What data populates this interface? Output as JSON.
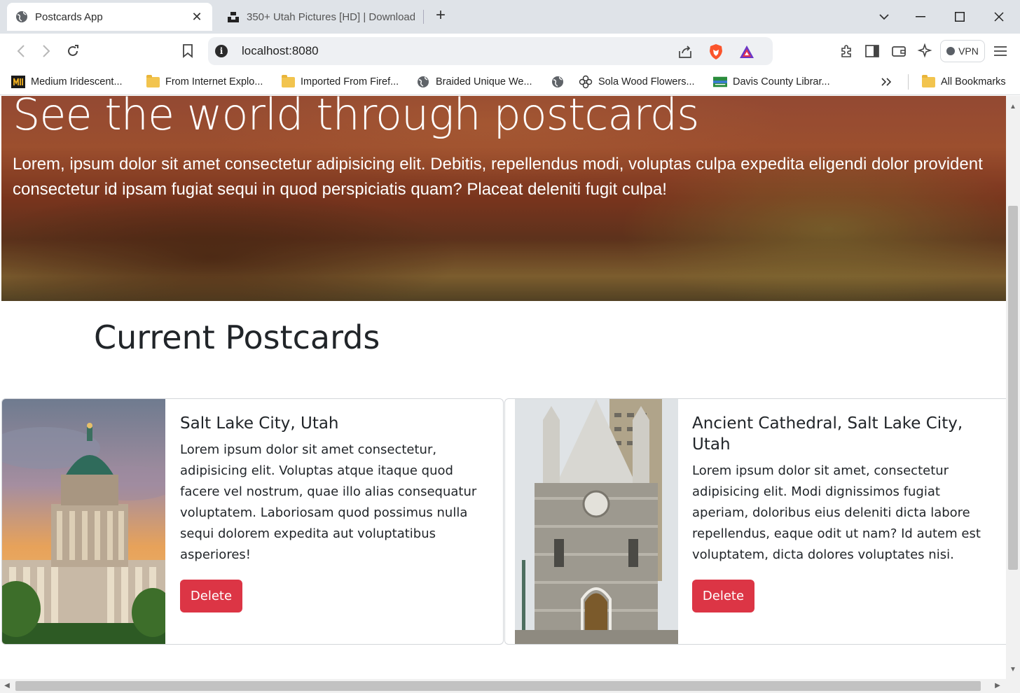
{
  "browser": {
    "tabs": [
      {
        "title": "Postcards App",
        "active": true
      },
      {
        "title": "350+ Utah Pictures [HD] | Download",
        "active": false
      }
    ],
    "url": "localhost:8080",
    "vpn_label": "VPN",
    "bookmarks": [
      {
        "label": "Medium Iridescent...",
        "icon": "medium-icon"
      },
      {
        "label": "From Internet Explo...",
        "icon": "folder-icon"
      },
      {
        "label": "Imported From Firef...",
        "icon": "folder-icon"
      },
      {
        "label": "Braided Unique We...",
        "icon": "globe-icon"
      },
      {
        "label": "",
        "icon": "globe-icon"
      },
      {
        "label": "Sola Wood Flowers...",
        "icon": "flower-icon"
      },
      {
        "label": "Davis County Librar...",
        "icon": "library-icon"
      },
      {
        "label": "All Bookmarks",
        "icon": "folder-icon"
      }
    ]
  },
  "hero": {
    "title": "See the world through postcards",
    "text": "Lorem, ipsum dolor sit amet consectetur adipisicing elit. Debitis, repellendus modi, voluptas culpa expedita eligendi dolor provident consectetur id ipsam fugiat sequi in quod perspiciatis quam? Placeat deleniti fugit culpa!"
  },
  "section_title": "Current Postcards",
  "postcards": [
    {
      "title": "Salt Lake City, Utah",
      "text": "Lorem ipsum dolor sit amet consectetur, adipisicing elit. Voluptas atque itaque quod facere vel nostrum, quae illo alias consequatur voluptatem. Laboriosam quod possimus nulla sequi dolorem expedita aut voluptatibus asperiores!",
      "button": "Delete"
    },
    {
      "title": "Ancient Cathedral, Salt Lake City, Utah",
      "text": "Lorem ipsum dolor sit amet, consectetur adipisicing elit. Modi dignissimos fugiat aperiam, doloribus eius deleniti dicta labore repellendus, eaque odit ut nam? Id autem est voluptatem, dicta dolores voluptates nisi.",
      "button": "Delete"
    }
  ],
  "colors": {
    "delete_button": "#dc3545",
    "text": "#212529",
    "tabbar": "#dfe3e8"
  }
}
